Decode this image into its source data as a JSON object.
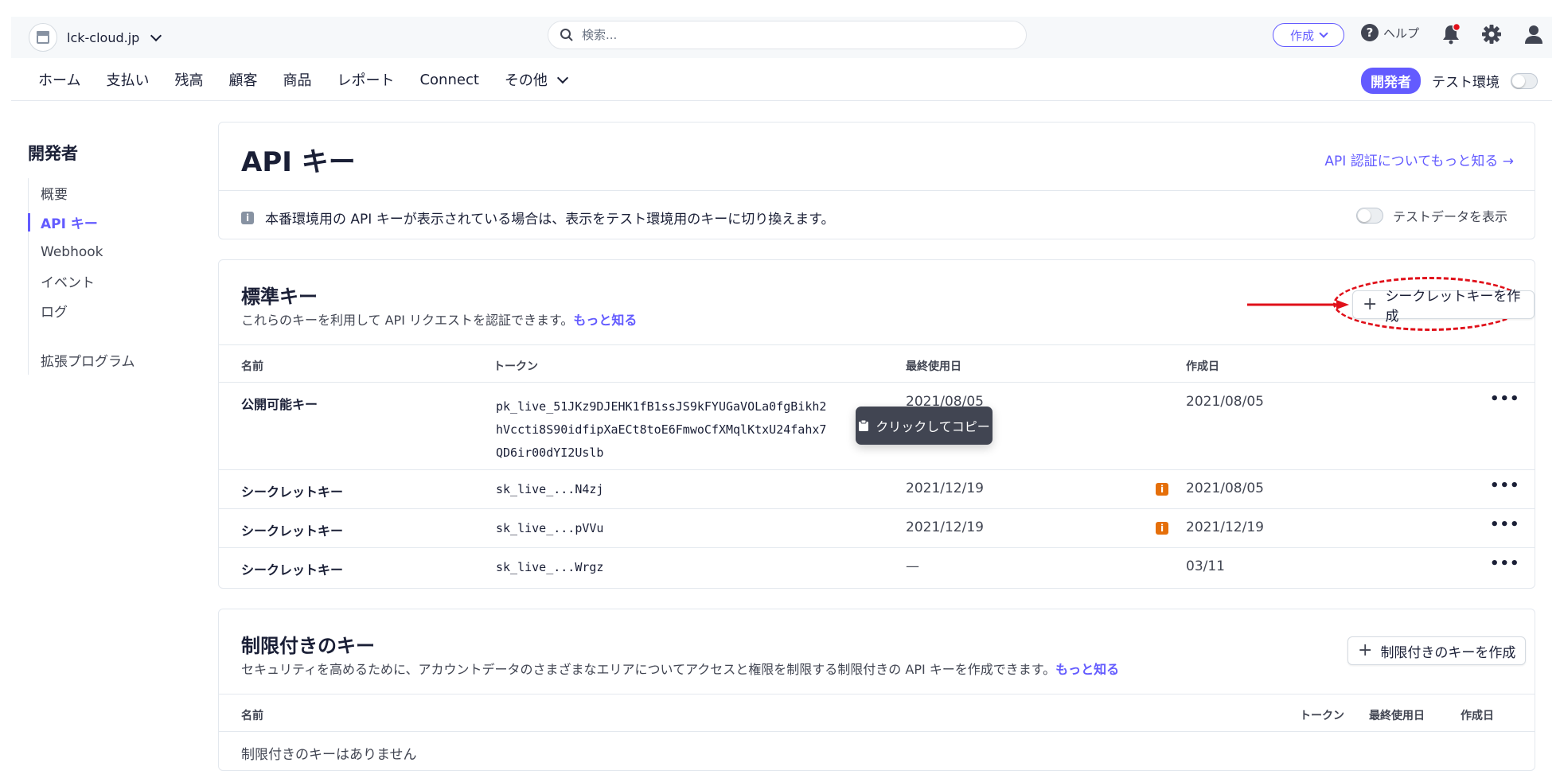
{
  "topbar": {
    "account_name": "lck-cloud.jp",
    "search_placeholder": "検索...",
    "create_label": "作成",
    "help_label": "ヘルプ"
  },
  "nav": {
    "items": [
      "ホーム",
      "支払い",
      "残高",
      "顧客",
      "商品",
      "レポート",
      "Connect",
      "その他"
    ],
    "developer_badge": "開発者",
    "test_env_label": "テスト環境"
  },
  "sidebar": {
    "title": "開発者",
    "items": [
      {
        "label": "概要",
        "active": false
      },
      {
        "label": "API キー",
        "active": true
      },
      {
        "label": "Webhook",
        "active": false
      },
      {
        "label": "イベント",
        "active": false
      },
      {
        "label": "ログ",
        "active": false
      }
    ],
    "extensions_label": "拡張プログラム"
  },
  "header": {
    "title": "API キー",
    "learn_link": "API 認証についてもっと知る →",
    "info_text": "本番環境用の API キーが表示されている場合は、表示をテスト環境用のキーに切り換えます。",
    "testdata_label": "テストデータを表示"
  },
  "standard_keys": {
    "title": "標準キー",
    "description": "これらのキーを利用して API リクエストを認証できます。",
    "learn_more": "もっと知る",
    "create_button": "シークレットキーを作成",
    "columns": {
      "name": "名前",
      "token": "トークン",
      "last_used": "最終使用日",
      "created": "作成日"
    },
    "rows": [
      {
        "name": "公開可能キー",
        "token_lines": [
          "pk_live_51JKz9DJEHK1fB1ssJS9kFYUGaVOLa0fgBikh2",
          "hVccti8S90idfipXaECt8toE6FmwoCfXMqlKtxU24fahx7",
          "QD6ir00dYI2Uslb"
        ],
        "last_used": "2021/08/05",
        "created": "2021/08/05"
      },
      {
        "name": "シークレットキー",
        "token_lines": [
          "sk_live_...N4zj"
        ],
        "last_used": "2021/12/19",
        "created": "2021/08/05",
        "warning": true
      },
      {
        "name": "シークレットキー",
        "token_lines": [
          "sk_live_...pVVu"
        ],
        "last_used": "2021/12/19",
        "created": "2021/12/19",
        "warning": true
      },
      {
        "name": "シークレットキー",
        "token_lines": [
          "sk_live_...Wrgz"
        ],
        "last_used": "—",
        "created": "03/11",
        "warning": false
      }
    ],
    "more_glyph": "•••",
    "tooltip": "クリックしてコピー"
  },
  "restricted_keys": {
    "title": "制限付きのキー",
    "description": "セキュリティを高めるために、アカウントデータのさまざまなエリアについてアクセスと権限を制限する制限付きの API キーを作成できます。",
    "learn_more": "もっと知る",
    "create_button": "制限付きのキーを作成",
    "columns": {
      "name": "名前",
      "token": "トークン",
      "last_used": "最終使用日",
      "created": "作成日"
    },
    "empty_text": "制限付きのキーはありません"
  },
  "colors": {
    "accent": "#635bff",
    "annotation": "#e0101a",
    "warning": "#e56f0a"
  }
}
